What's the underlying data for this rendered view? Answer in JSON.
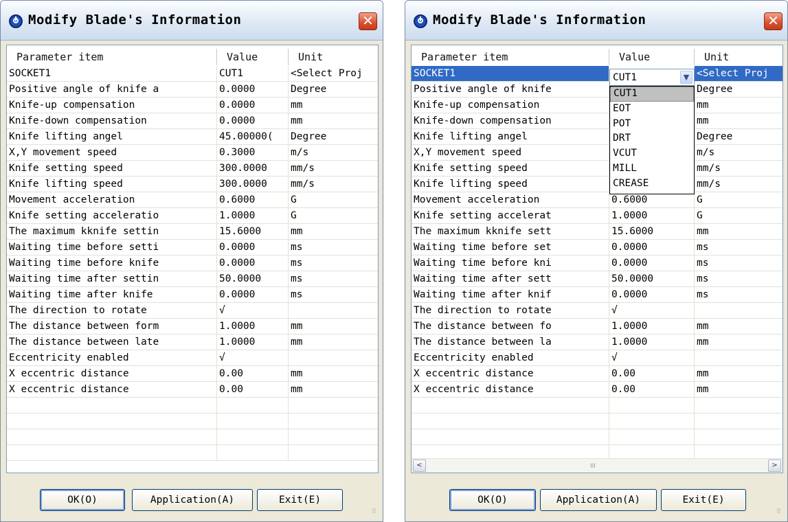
{
  "title": "Modify Blade's Information",
  "close_glyph": "✕",
  "columns": [
    "Parameter item",
    "Value",
    "Unit"
  ],
  "buttons": {
    "ok": "OK(O)",
    "application": "Application(A)",
    "exit": "Exit(E)"
  },
  "left": {
    "rows": [
      [
        "SOCKET1",
        "CUT1",
        "<Select Proj"
      ],
      [
        "Positive angle of knife a",
        "0.0000",
        "Degree"
      ],
      [
        "Knife-up compensation",
        "0.0000",
        "mm"
      ],
      [
        "Knife-down compensation",
        "0.0000",
        "mm"
      ],
      [
        "Knife lifting angel",
        "45.00000(",
        "Degree"
      ],
      [
        "X,Y movement speed",
        "0.3000",
        "m/s"
      ],
      [
        "Knife setting speed",
        "300.0000",
        "mm/s"
      ],
      [
        "Knife lifting speed",
        "300.0000",
        "mm/s"
      ],
      [
        "Movement acceleration",
        "0.6000",
        "G"
      ],
      [
        "Knife setting acceleratio",
        "1.0000",
        "G"
      ],
      [
        "The maximum kknife settin",
        "15.6000",
        "mm"
      ],
      [
        "Waiting time before setti",
        "0.0000",
        "ms"
      ],
      [
        "Waiting time before knife",
        "0.0000",
        "ms"
      ],
      [
        "Waiting time after settin",
        "50.0000",
        "ms"
      ],
      [
        "Waiting time after knife",
        "0.0000",
        "ms"
      ],
      [
        "The direction to rotate",
        "√",
        ""
      ],
      [
        "The distance between form",
        "1.0000",
        "mm"
      ],
      [
        "The distance between late",
        "1.0000",
        "mm"
      ],
      [
        "Eccentricity enabled",
        "√",
        ""
      ],
      [
        "X eccentric distance",
        "0.00",
        "mm"
      ],
      [
        "X eccentric distance",
        "0.00",
        "mm"
      ]
    ]
  },
  "right": {
    "rows": [
      [
        "SOCKET1",
        "",
        "<Select Proj"
      ],
      [
        "Positive angle of knife",
        "",
        "Degree"
      ],
      [
        "Knife-up compensation",
        "",
        "mm"
      ],
      [
        "Knife-down compensation",
        "",
        "mm"
      ],
      [
        "Knife lifting angel",
        "",
        "Degree"
      ],
      [
        "X,Y movement speed",
        "",
        "m/s"
      ],
      [
        "Knife setting speed",
        "",
        "mm/s"
      ],
      [
        "Knife lifting speed",
        "",
        "mm/s"
      ],
      [
        "Movement acceleration",
        "0.6000",
        "G"
      ],
      [
        "Knife setting accelerat",
        "1.0000",
        "G"
      ],
      [
        "The maximum kknife sett",
        "15.6000",
        "mm"
      ],
      [
        "Waiting time before set",
        "0.0000",
        "ms"
      ],
      [
        "Waiting time before kni",
        "0.0000",
        "ms"
      ],
      [
        "Waiting time after sett",
        "50.0000",
        "ms"
      ],
      [
        "Waiting time after knif",
        "0.0000",
        "ms"
      ],
      [
        "The direction to rotate",
        "√",
        ""
      ],
      [
        "The distance between fo",
        "1.0000",
        "mm"
      ],
      [
        "The distance between la",
        "1.0000",
        "mm"
      ],
      [
        "Eccentricity enabled",
        "√",
        ""
      ],
      [
        "X eccentric distance",
        "0.00",
        "mm"
      ],
      [
        "X eccentric distance",
        "0.00",
        "mm"
      ]
    ],
    "combo_value": "CUT1",
    "dropdown_options": [
      "CUT1",
      "EOT",
      "POT",
      "DRT",
      "VCUT",
      "MILL",
      "CREASE"
    ],
    "highlighted_option": "CUT1",
    "scroll_left": "<",
    "scroll_right": ">",
    "scroll_grip": "III"
  }
}
